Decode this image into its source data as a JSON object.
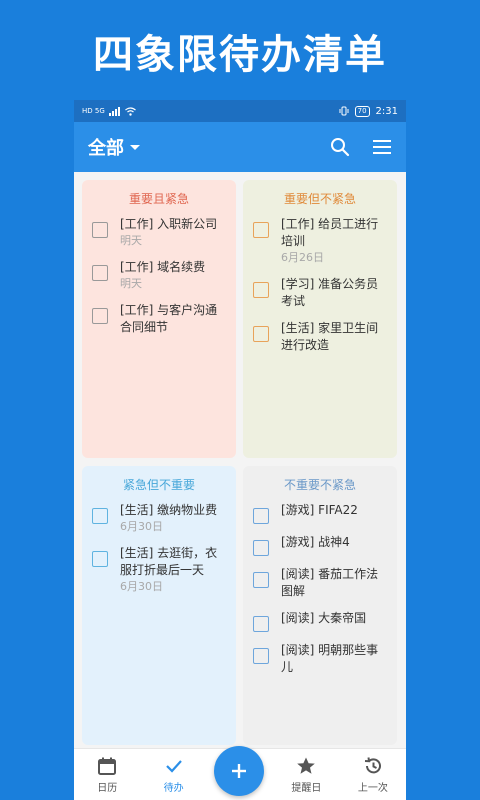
{
  "banner": {
    "title": "四象限待办清单"
  },
  "statusbar": {
    "left": "HD 5G",
    "battery": "70",
    "time": "2:31"
  },
  "appbar": {
    "filter_label": "全部"
  },
  "quadrants": [
    {
      "title": "重要且紧急",
      "tasks": [
        {
          "text": "[工作] 入职新公司",
          "date": "明天"
        },
        {
          "text": "[工作] 域名续费",
          "date": "明天"
        },
        {
          "text": "[工作] 与客户沟通合同细节",
          "date": ""
        }
      ]
    },
    {
      "title": "重要但不紧急",
      "tasks": [
        {
          "text": "[工作] 给员工进行培训",
          "date": "6月26日"
        },
        {
          "text": "[学习] 准备公务员考试",
          "date": ""
        },
        {
          "text": "[生活] 家里卫生间进行改造",
          "date": ""
        }
      ]
    },
    {
      "title": "紧急但不重要",
      "tasks": [
        {
          "text": "[生活] 缴纳物业费",
          "date": "6月30日"
        },
        {
          "text": "[生活] 去逛街，衣服打折最后一天",
          "date": "6月30日"
        }
      ]
    },
    {
      "title": "不重要不紧急",
      "tasks": [
        {
          "text": "[游戏] FIFA22",
          "date": ""
        },
        {
          "text": "[游戏] 战神4",
          "date": ""
        },
        {
          "text": "[阅读] 番茄工作法图解",
          "date": ""
        },
        {
          "text": "[阅读] 大秦帝国",
          "date": ""
        },
        {
          "text": "[阅读] 明朝那些事儿",
          "date": ""
        }
      ]
    }
  ],
  "bottom_nav": {
    "calendar": "日历",
    "todo": "待办",
    "reminder": "提醒日",
    "previous": "上一次"
  },
  "colors": {
    "background": "#1a7fdc",
    "appbar": "#2b8fe8",
    "q1": "#fde4de",
    "q2": "#eef0e0",
    "q3": "#e3f1fc",
    "q4": "#efefef"
  }
}
